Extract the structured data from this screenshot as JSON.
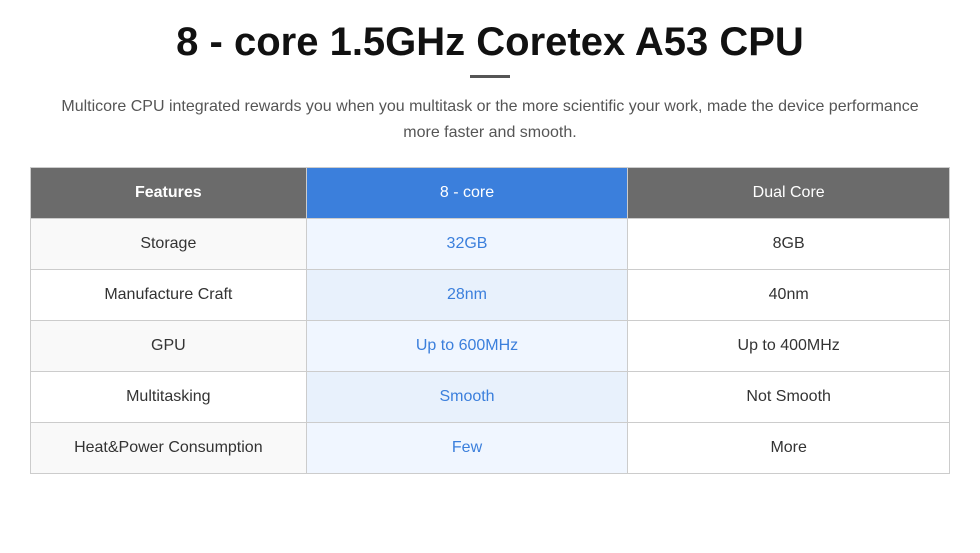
{
  "header": {
    "title": "8 - core 1.5GHz Coretex A53 CPU",
    "subtitle": "Multicore CPU integrated rewards you when you multitask or the more scientific your work, made the device performance more faster and smooth."
  },
  "table": {
    "columns": {
      "features_label": "Features",
      "col1_label": "8 - core",
      "col2_label": "Dual Core"
    },
    "rows": [
      {
        "feature": "Storage",
        "col1": "32GB",
        "col2": "8GB"
      },
      {
        "feature": "Manufacture Craft",
        "col1": "28nm",
        "col2": "40nm"
      },
      {
        "feature": "GPU",
        "col1": "Up to 600MHz",
        "col2": "Up to 400MHz"
      },
      {
        "feature": "Multitasking",
        "col1": "Smooth",
        "col2": "Not Smooth"
      },
      {
        "feature": "Heat&Power Consumption",
        "col1": "Few",
        "col2": "More"
      }
    ]
  }
}
